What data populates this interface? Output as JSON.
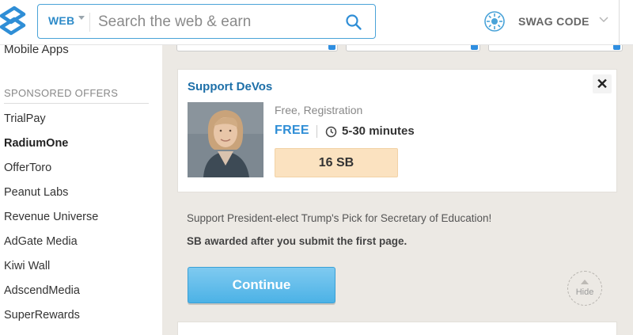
{
  "header": {
    "search_scope": "WEB",
    "search_placeholder": "Search the web & earn",
    "swag_code_label": "SWAG CODE"
  },
  "sidebar": {
    "partial_item": "Mobile Apps",
    "heading": "SPONSORED OFFERS",
    "items": [
      {
        "label": "TrialPay",
        "active": false
      },
      {
        "label": "RadiumOne",
        "active": true
      },
      {
        "label": "OfferToro",
        "active": false
      },
      {
        "label": "Peanut Labs",
        "active": false
      },
      {
        "label": "Revenue Universe",
        "active": false
      },
      {
        "label": "AdGate Media",
        "active": false
      },
      {
        "label": "Kiwi Wall",
        "active": false
      },
      {
        "label": "AdscendMedia",
        "active": false
      },
      {
        "label": "SuperRewards",
        "active": false
      }
    ]
  },
  "offer": {
    "title": "Support DeVos",
    "close_glyph": "✕",
    "meta": "Free, Registration",
    "price": "FREE",
    "time": "5-30 minutes",
    "reward": "16 SB",
    "description": "Support President-elect Trump's Pick for Secretary of Education!",
    "note": "SB awarded after you submit the first page.",
    "continue_label": "Continue",
    "hide_label": "Hide"
  },
  "colors": {
    "accent_blue": "#2f8ed6",
    "title_blue": "#1d6fa8",
    "reward_bg": "#fbe2c0",
    "button_blue": "#4cb2e6",
    "panel_bg": "#ece9e4"
  },
  "icons": {
    "logo": "swagbucks-logo-icon",
    "search": "search-icon",
    "swag": "swag-code-icon",
    "caret": "chevron-down-icon",
    "clock": "clock-icon",
    "close": "close-icon",
    "hide": "chevron-up-icon"
  }
}
